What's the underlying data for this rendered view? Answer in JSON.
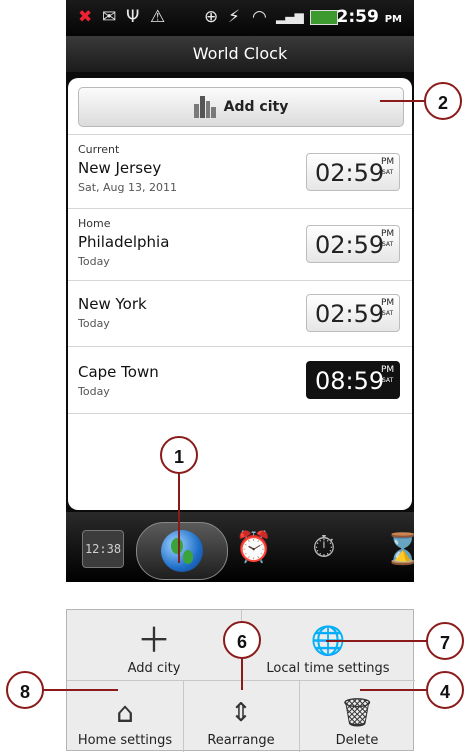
{
  "status_bar": {
    "icons": [
      "missed-call-icon",
      "mail-icon",
      "usb-icon",
      "warning-icon",
      "location-icon",
      "signal-icon",
      "wifi-icon",
      "cell-signal-icon",
      "battery-icon"
    ],
    "time": "2:59",
    "time_suffix": "PM"
  },
  "title": "World Clock",
  "add_city_button": "Add city",
  "cities": [
    {
      "label": "Current",
      "name": "New Jersey",
      "sub": "Sat, Aug 13, 2011",
      "time": "02:59",
      "ampm": "PM",
      "day": "SAT",
      "dark": false
    },
    {
      "label": "Home",
      "name": "Philadelphia",
      "sub": "Today",
      "time": "02:59",
      "ampm": "PM",
      "day": "SAT",
      "dark": false
    },
    {
      "label": "",
      "name": "New York",
      "sub": "Today",
      "time": "02:59",
      "ampm": "PM",
      "day": "SAT",
      "dark": false
    },
    {
      "label": "",
      "name": "Cape Town",
      "sub": "Today",
      "time": "08:59",
      "ampm": "PM",
      "day": "SAT",
      "dark": true
    }
  ],
  "tabs": {
    "clock_text": "12:38",
    "icons": [
      "desk-clock-icon",
      "world-clock-icon",
      "alarm-icon",
      "stopwatch-icon",
      "timer-icon"
    ],
    "selected": "world-clock-icon"
  },
  "menu": {
    "items": [
      {
        "label": "Add city",
        "icon": "plus-icon"
      },
      {
        "label": "Local time settings",
        "icon": "globe-clock-icon"
      },
      {
        "label": "Home settings",
        "icon": "home-clock-icon"
      },
      {
        "label": "Rearrange",
        "icon": "rearrange-icon"
      },
      {
        "label": "Delete",
        "icon": "trash-icon"
      }
    ]
  },
  "callouts": [
    "1",
    "2",
    "4",
    "6",
    "7",
    "8"
  ],
  "colors": {
    "callout": "#8b1a1a",
    "dark_clock": "#111111"
  }
}
